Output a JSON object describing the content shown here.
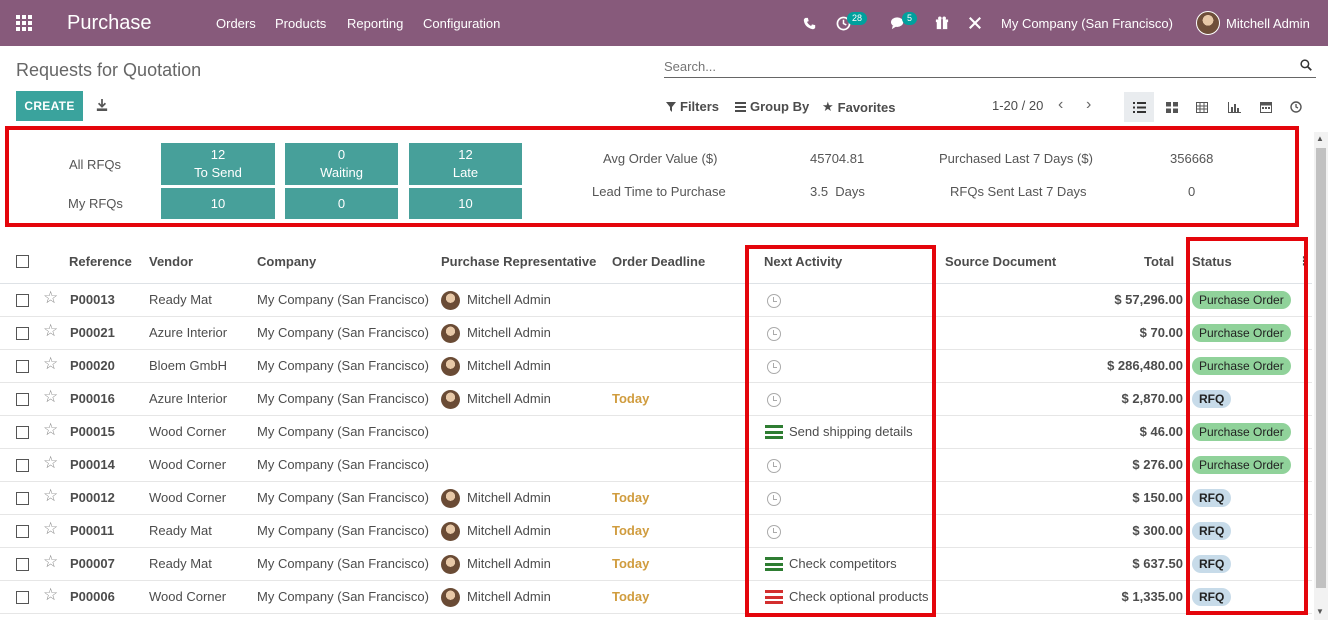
{
  "navbar": {
    "app_name": "Purchase",
    "menus": [
      "Orders",
      "Products",
      "Reporting",
      "Configuration"
    ],
    "activity_count": "28",
    "message_count": "5",
    "company": "My Company (San Francisco)",
    "user": "Mitchell Admin",
    "color": "#875a7b"
  },
  "control": {
    "title": "Requests for Quotation",
    "search_placeholder": "Search...",
    "create_label": "CREATE",
    "filters_label": "Filters",
    "groupby_label": "Group By",
    "favorites_label": "Favorites",
    "pager": "1-20 / 20",
    "views": [
      "list-icon",
      "kanban-icon",
      "pivot-icon",
      "graph-icon",
      "calendar-icon",
      "activity-icon"
    ]
  },
  "dashboard": {
    "all_rfqs_label": "All RFQs",
    "my_rfqs_label": "My RFQs",
    "tiles": [
      {
        "count": "12",
        "label": "To Send",
        "mine": "10"
      },
      {
        "count": "0",
        "label": "Waiting",
        "mine": "0"
      },
      {
        "count": "12",
        "label": "Late",
        "mine": "10"
      }
    ],
    "avg_order_label": "Avg Order Value ($)",
    "avg_order_value": "45704.81",
    "lead_time_label": "Lead Time to Purchase",
    "lead_time_value": "3.5  Days",
    "purchased_label": "Purchased Last 7 Days ($)",
    "purchased_value": "356668",
    "rfq_sent_label": "RFQs Sent Last 7 Days",
    "rfq_sent_value": "0"
  },
  "table": {
    "headers": {
      "reference": "Reference",
      "vendor": "Vendor",
      "company": "Company",
      "rep": "Purchase Representative",
      "deadline": "Order Deadline",
      "activity": "Next Activity",
      "source": "Source Document",
      "total": "Total",
      "status": "Status"
    },
    "rows": [
      {
        "ref": "P00013",
        "vendor": "Ready Mat",
        "company": "My Company (San Francisco)",
        "rep": "Mitchell Admin",
        "deadline": "",
        "activity": "",
        "activity_color": "",
        "total": "$ 57,296.00",
        "status": "Purchase Order",
        "status_type": "po"
      },
      {
        "ref": "P00021",
        "vendor": "Azure Interior",
        "company": "My Company (San Francisco)",
        "rep": "Mitchell Admin",
        "deadline": "",
        "activity": "",
        "activity_color": "",
        "total": "$ 70.00",
        "status": "Purchase Order",
        "status_type": "po"
      },
      {
        "ref": "P00020",
        "vendor": "Bloem GmbH",
        "company": "My Company (San Francisco)",
        "rep": "Mitchell Admin",
        "deadline": "",
        "activity": "",
        "activity_color": "",
        "total": "$ 286,480.00",
        "status": "Purchase Order",
        "status_type": "po"
      },
      {
        "ref": "P00016",
        "vendor": "Azure Interior",
        "company": "My Company (San Francisco)",
        "rep": "Mitchell Admin",
        "deadline": "Today",
        "activity": "",
        "activity_color": "",
        "total": "$ 2,870.00",
        "status": "RFQ",
        "status_type": "rfq"
      },
      {
        "ref": "P00015",
        "vendor": "Wood Corner",
        "company": "My Company (San Francisco)",
        "rep": "",
        "deadline": "",
        "activity": "Send shipping details",
        "activity_color": "#2e7d32",
        "total": "$ 46.00",
        "status": "Purchase Order",
        "status_type": "po"
      },
      {
        "ref": "P00014",
        "vendor": "Wood Corner",
        "company": "My Company (San Francisco)",
        "rep": "",
        "deadline": "",
        "activity": "",
        "activity_color": "",
        "total": "$ 276.00",
        "status": "Purchase Order",
        "status_type": "po"
      },
      {
        "ref": "P00012",
        "vendor": "Wood Corner",
        "company": "My Company (San Francisco)",
        "rep": "Mitchell Admin",
        "deadline": "Today",
        "activity": "",
        "activity_color": "",
        "total": "$ 150.00",
        "status": "RFQ",
        "status_type": "rfq"
      },
      {
        "ref": "P00011",
        "vendor": "Ready Mat",
        "company": "My Company (San Francisco)",
        "rep": "Mitchell Admin",
        "deadline": "Today",
        "activity": "",
        "activity_color": "",
        "total": "$ 300.00",
        "status": "RFQ",
        "status_type": "rfq"
      },
      {
        "ref": "P00007",
        "vendor": "Ready Mat",
        "company": "My Company (San Francisco)",
        "rep": "Mitchell Admin",
        "deadline": "Today",
        "activity": "Check competitors",
        "activity_color": "#2e7d32",
        "total": "$ 637.50",
        "status": "RFQ",
        "status_type": "rfq"
      },
      {
        "ref": "P00006",
        "vendor": "Wood Corner",
        "company": "My Company (San Francisco)",
        "rep": "Mitchell Admin",
        "deadline": "Today",
        "activity": "Check optional products",
        "activity_color": "#d32f2f",
        "total": "$ 1,335.00",
        "status": "RFQ",
        "status_type": "rfq"
      }
    ]
  }
}
